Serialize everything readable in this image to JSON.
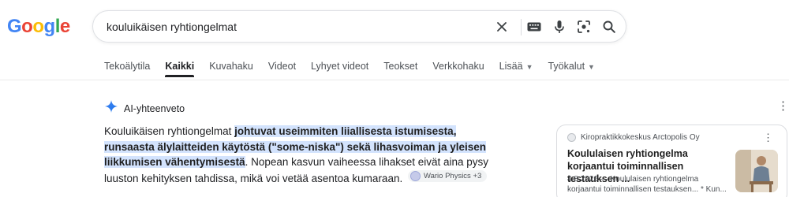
{
  "logo": {
    "letters": [
      {
        "ch": "G",
        "color": "#4285F4"
      },
      {
        "ch": "o",
        "color": "#EA4335"
      },
      {
        "ch": "o",
        "color": "#FBBC05"
      },
      {
        "ch": "g",
        "color": "#4285F4"
      },
      {
        "ch": "l",
        "color": "#34A853"
      },
      {
        "ch": "e",
        "color": "#EA4335"
      }
    ]
  },
  "search": {
    "query": "kouluikäisen ryhtiongelmat",
    "icons": [
      "clear-icon",
      "keyboard-icon",
      "mic-icon",
      "lens-icon",
      "search-icon"
    ]
  },
  "tabs": [
    {
      "label": "Tekoälytila",
      "active": false
    },
    {
      "label": "Kaikki",
      "active": true
    },
    {
      "label": "Kuvahaku",
      "active": false
    },
    {
      "label": "Videot",
      "active": false
    },
    {
      "label": "Lyhyet videot",
      "active": false
    },
    {
      "label": "Teokset",
      "active": false
    },
    {
      "label": "Verkkohaku",
      "active": false
    },
    {
      "label": "Lisää",
      "active": false,
      "dropdown": true
    },
    {
      "label": "Työkalut",
      "active": false,
      "dropdown": true
    }
  ],
  "ai_overview": {
    "title": "AI-yhteenveto",
    "body_prefix": "Kouluikäisen ryhtiongelmat ",
    "body_highlight": "johtuvat useimmiten liiallisesta istumisesta, runsaasta älylaitteiden käytöstä (\"some-niska\") sekä lihasvoiman ja yleisen liikkumisen vähentymisestä",
    "body_suffix": ". Nopean kasvun vaiheessa lihakset eivät aina pysy luuston kehityksen tahdissa, mikä voi vetää asentoa kumaraan.",
    "source_chip": "Wario Physics +3"
  },
  "source_card": {
    "site": "Kiropraktikkokeskus Arctopolis Oy",
    "title": "Koululaisen ryhtiongelma korjaantui toiminnallisen testauksen ...",
    "snippet": "4.8.2026 — Koululaisen ryhtiongelma korjaantui toiminnallisen testauksen... * Kun..."
  },
  "colors": {
    "highlight": "#d3e3fd",
    "accent_blue": "#4285F4"
  }
}
